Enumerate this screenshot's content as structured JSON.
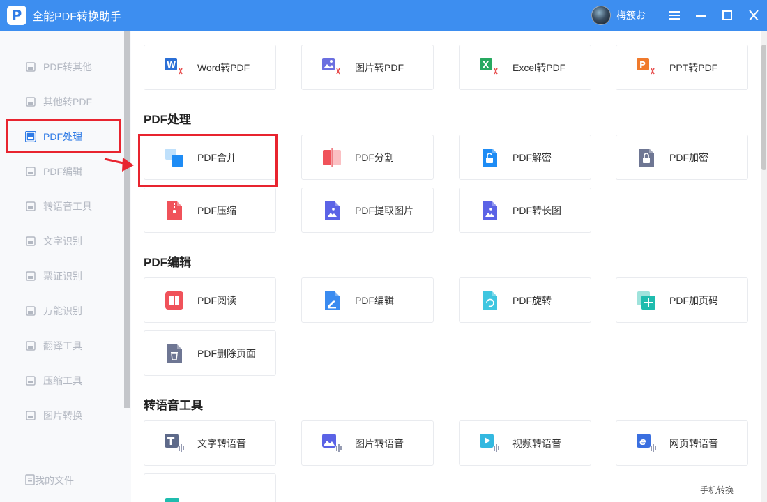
{
  "app": {
    "title": "全能PDF转换助手",
    "logo_letter": "P",
    "username": "梅簇お"
  },
  "window_controls": [
    "menu-icon",
    "minimize-icon",
    "maximize-icon",
    "close-icon"
  ],
  "sidebar": {
    "items": [
      {
        "label": "PDF转其他",
        "icon": "pdf-export-icon",
        "active": false
      },
      {
        "label": "其他转PDF",
        "icon": "pdf-import-icon",
        "active": false
      },
      {
        "label": "PDF处理",
        "icon": "pdf-process-icon",
        "active": true
      },
      {
        "label": "PDF编辑",
        "icon": "pdf-edit-icon",
        "active": false
      },
      {
        "label": "转语音工具",
        "icon": "voice-tool-icon",
        "active": false
      },
      {
        "label": "文字识别",
        "icon": "ocr-icon",
        "active": false
      },
      {
        "label": "票证识别",
        "icon": "ticket-icon",
        "active": false
      },
      {
        "label": "万能识别",
        "icon": "scan-icon",
        "active": false
      },
      {
        "label": "翻译工具",
        "icon": "translate-icon",
        "active": false
      },
      {
        "label": "压缩工具",
        "icon": "compress-icon",
        "active": false
      },
      {
        "label": "图片转换",
        "icon": "image-convert-icon",
        "active": false
      }
    ],
    "footer": {
      "label": "我的文件",
      "icon": "my-files-icon"
    }
  },
  "top_tools": [
    {
      "label": "Word转PDF",
      "icon": "word-to-pdf-icon",
      "color": "#2b6fd6"
    },
    {
      "label": "图片转PDF",
      "icon": "image-to-pdf-icon",
      "color": "#6b6fe0"
    },
    {
      "label": "Excel转PDF",
      "icon": "excel-to-pdf-icon",
      "color": "#27a960"
    },
    {
      "label": "PPT转PDF",
      "icon": "ppt-to-pdf-icon",
      "color": "#f07a2c"
    }
  ],
  "sections": [
    {
      "title": "PDF处理",
      "tools": [
        {
          "label": "PDF合并",
          "icon": "merge-icon",
          "color": "#1e8cf5"
        },
        {
          "label": "PDF分割",
          "icon": "split-icon",
          "color": "#f0525a"
        },
        {
          "label": "PDF解密",
          "icon": "unlock-icon",
          "color": "#1e8cf5"
        },
        {
          "label": "PDF加密",
          "icon": "lock-icon",
          "color": "#6e7693"
        },
        {
          "label": "PDF压缩",
          "icon": "zip-icon",
          "color": "#f0525a"
        },
        {
          "label": "PDF提取图片",
          "icon": "extract-image-icon",
          "color": "#5b63e6"
        },
        {
          "label": "PDF转长图",
          "icon": "long-image-icon",
          "color": "#5b63e6"
        }
      ]
    },
    {
      "title": "PDF编辑",
      "tools": [
        {
          "label": "PDF阅读",
          "icon": "reader-icon",
          "color": "#f0525a"
        },
        {
          "label": "PDF编辑",
          "icon": "edit-icon",
          "color": "#3a8bf0"
        },
        {
          "label": "PDF旋转",
          "icon": "rotate-icon",
          "color": "#3fc6e0"
        },
        {
          "label": "PDF加页码",
          "icon": "page-number-icon",
          "color": "#1fbcae"
        },
        {
          "label": "PDF删除页面",
          "icon": "delete-page-icon",
          "color": "#6e7693"
        }
      ]
    },
    {
      "title": "转语音工具",
      "tools": [
        {
          "label": "文字转语音",
          "icon": "text-to-speech-icon",
          "color": "#5e6a8a"
        },
        {
          "label": "图片转语音",
          "icon": "image-to-speech-icon",
          "color": "#5b63e6"
        },
        {
          "label": "视频转语音",
          "icon": "video-to-speech-icon",
          "color": "#33b8e0"
        },
        {
          "label": "网页转语音",
          "icon": "web-to-speech-icon",
          "color": "#3a6fe0"
        }
      ]
    }
  ],
  "bottom_link": "手机转换"
}
